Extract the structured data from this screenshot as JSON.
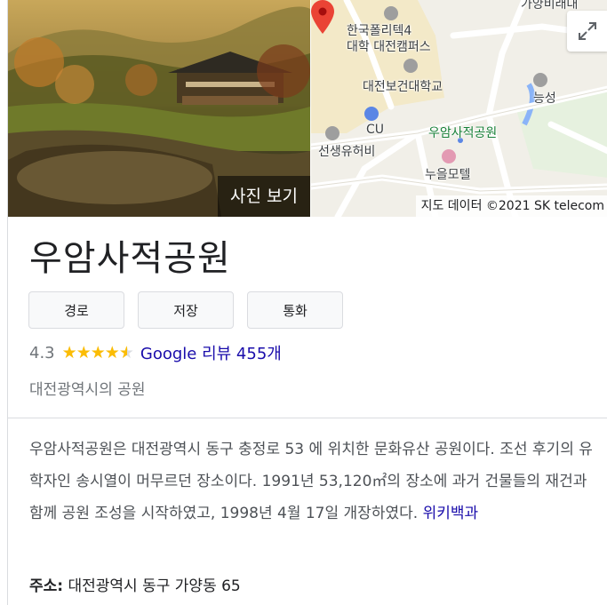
{
  "hero": {
    "photo_button_label": "사진 보기",
    "map_attribution": "지도 데이터 ©2021 SK telecom",
    "map_labels": {
      "top_partial": "가양비래대",
      "polytech_line1": "한국폴리텍4",
      "polytech_line2": "대학 대전캠퍼스",
      "health_univ": "대전보건대학교",
      "park": "우암사적공원",
      "cu": "CU",
      "neungseong": "능성",
      "shrine": "선생유허비",
      "motel": "누을모텔"
    },
    "pin_color": "#ea4335"
  },
  "place": {
    "title": "우암사적공원",
    "actions": [
      "경로",
      "저장",
      "통화"
    ],
    "rating": "4.3",
    "stars": 4.3,
    "reviews_label": "Google 리뷰 455개",
    "category": "대전광역시의 공원"
  },
  "description": {
    "text": "우암사적공원은 대전광역시 동구 충정로 53 에 위치한 문화유산 공원이다. 조선 후기의 유학자인 송시열이 머무르던 장소이다. 1991년 53,120㎡의 장소에 과거 건물들의 재건과 함께 공원 조성을 시작하였고, 1998년 4월 17일 개장하였다.",
    "source_link": "위키백과"
  },
  "address": {
    "label": "주소:",
    "value": "대전광역시 동구 가양동 65"
  },
  "colors": {
    "link": "#1a0dab",
    "star": "#fbbc04",
    "park_label": "#188038"
  }
}
